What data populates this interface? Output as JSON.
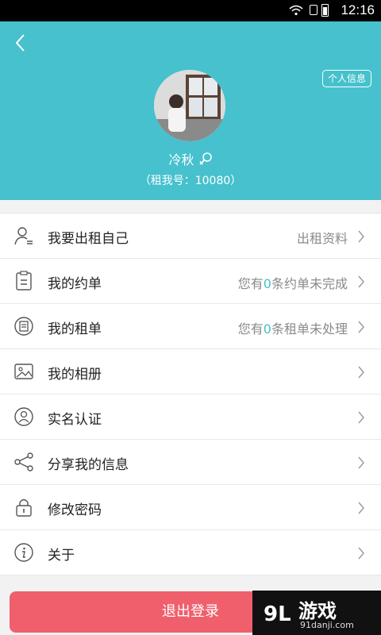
{
  "status": {
    "time": "12:16"
  },
  "header": {
    "info_button": "个人信息",
    "name": "冷秋",
    "id_line": "（租我号：10080）"
  },
  "menu": [
    {
      "label": "我要出租自己",
      "sub": "出租资料",
      "icon": "person-icon"
    },
    {
      "label": "我的约单",
      "sub_prefix": "您有",
      "sub_num": "0",
      "sub_suffix": "条约单未完成",
      "icon": "clipboard-icon"
    },
    {
      "label": "我的租单",
      "sub_prefix": "您有",
      "sub_num": "0",
      "sub_suffix": "条租单未处理",
      "icon": "order-icon"
    },
    {
      "label": "我的相册",
      "icon": "album-icon"
    },
    {
      "label": "实名认证",
      "icon": "verify-icon"
    },
    {
      "label": "分享我的信息",
      "icon": "share-icon"
    },
    {
      "label": "修改密码",
      "icon": "lock-icon"
    },
    {
      "label": "关于",
      "icon": "info-icon"
    }
  ],
  "logout_label": "退出登录",
  "watermark": {
    "brand": "游戏",
    "logo_text": "9L",
    "site": "91danji.com"
  },
  "colors": {
    "accent": "#46c1cd",
    "logout": "#ef5f6c"
  }
}
